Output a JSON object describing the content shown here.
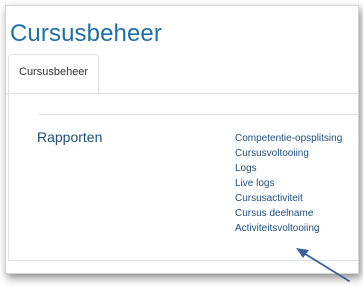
{
  "page": {
    "title": "Cursusbeheer"
  },
  "tabs": [
    {
      "label": "Cursusbeheer"
    }
  ],
  "section": {
    "title": "Rapporten",
    "links": [
      "Competentie-opsplitsing",
      "Cursusvoltooiing",
      "Logs",
      "Live logs",
      "Cursusactiviteit",
      "Cursus deelname",
      "Activiteitsvoltooiing"
    ]
  },
  "annotation": {
    "icon": "pointer-arrow-icon",
    "color": "#3d5f9c"
  },
  "colors": {
    "title": "#1f6fa8",
    "link": "#1f4f7c"
  }
}
